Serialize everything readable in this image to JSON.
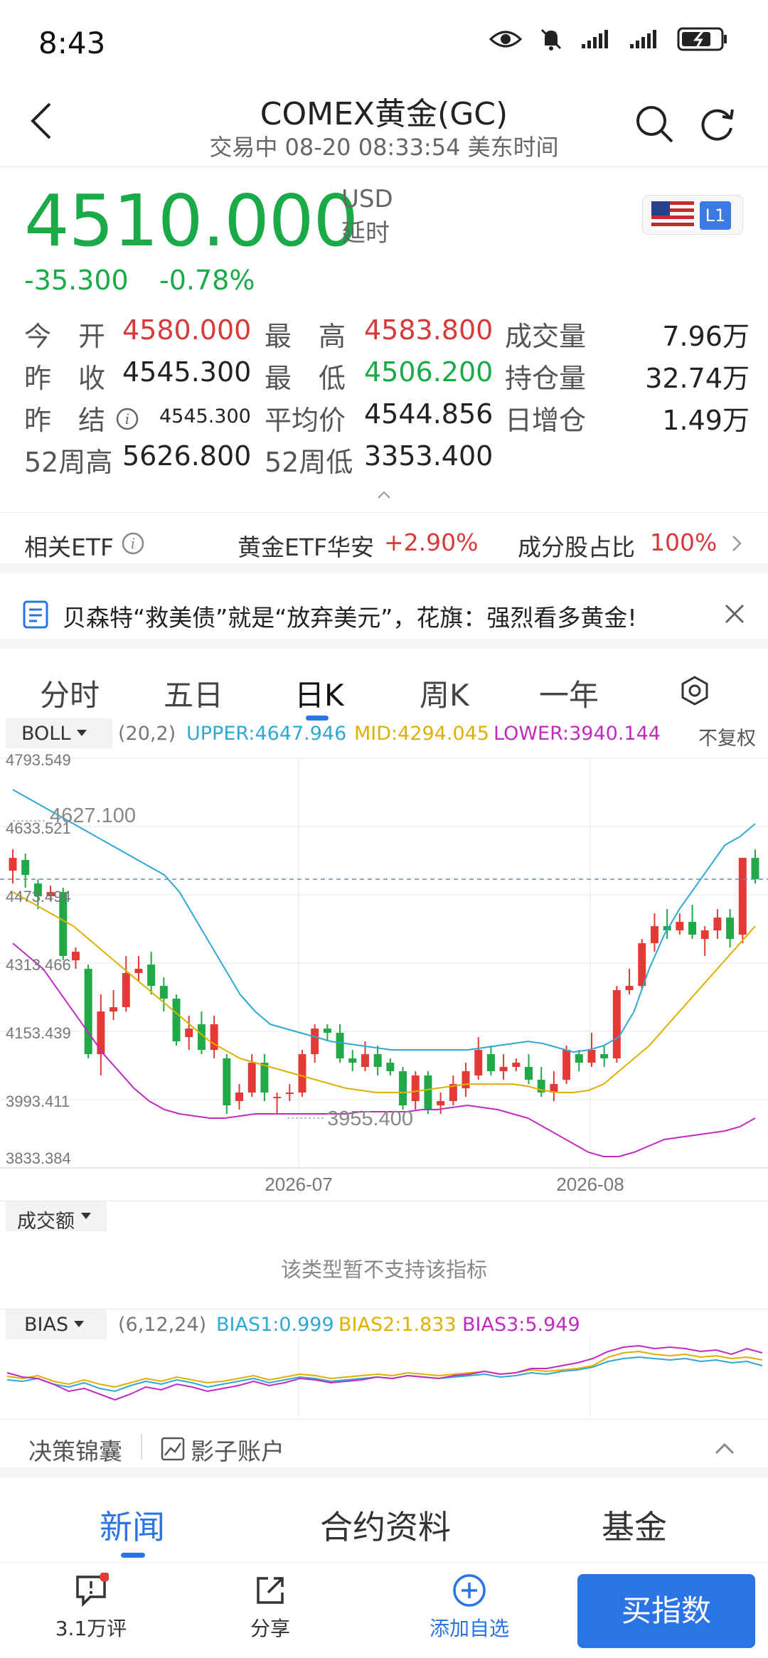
{
  "status_bar": {
    "time": "8:43"
  },
  "header": {
    "title": "COMEX黄金(GC)",
    "subtitle": "交易中 08-20 08:33:54 美东时间"
  },
  "quote": {
    "price": "4510.000",
    "currency": "USD",
    "delay": "延时",
    "change": "-35.300",
    "change_pct": "-0.78%",
    "level_badge": "L1"
  },
  "stats": [
    {
      "l1": "今　开",
      "v1": "4580.000",
      "c1": "red",
      "l2": "最　高",
      "v2": "4583.800",
      "c2": "red",
      "l3": "成交量",
      "v3": "7.96万"
    },
    {
      "l1": "昨　收",
      "v1": "4545.300",
      "c1": "",
      "l2": "最　低",
      "v2": "4506.200",
      "c2": "green",
      "l3": "持仓量",
      "v3": "32.74万"
    },
    {
      "l1": "昨　结",
      "v1": "4545.300",
      "c1": "",
      "l2": "平均价",
      "v2": "4544.856",
      "c2": "",
      "l3": "日增仓",
      "v3": "1.49万"
    },
    {
      "l1": "52周高",
      "v1": "5626.800",
      "c1": "",
      "l2": "52周低",
      "v2": "3353.400",
      "c2": "",
      "l3": "",
      "v3": ""
    }
  ],
  "etf": {
    "label": "相关ETF",
    "name": "黄金ETF华安",
    "change": "+2.90%",
    "ratio_label": "成分股占比",
    "ratio": "100%"
  },
  "news_banner": {
    "text": "贝森特“救美债”就是“放弃美元”，花旗：强烈看多黄金!"
  },
  "chart_tabs": [
    "分时",
    "五日",
    "日K",
    "周K",
    "一年"
  ],
  "active_tab": 2,
  "boll": {
    "name": "BOLL",
    "params": "(20,2)",
    "upper": "UPPER:4647.946",
    "mid": "MID:4294.045",
    "lower": "LOWER:3940.144",
    "adjust": "不复权",
    "colors": {
      "upper": "#2fa8d6",
      "mid": "#e0b000",
      "lower": "#c02bc0"
    }
  },
  "chart_data": {
    "type": "candlestick",
    "y_ticks": [
      "4793.549",
      "4633.521",
      "4473.494",
      "4313.466",
      "4153.439",
      "3993.411",
      "3833.384"
    ],
    "ylim": [
      3833.384,
      4793.549
    ],
    "x_ticks": [
      "2026-07",
      "2026-08"
    ],
    "annotations": {
      "high": "4627.100",
      "low": "3955.400"
    },
    "reference_price": 4510.0,
    "candles": [
      {
        "o": 4530,
        "c": 4560,
        "h": 4580,
        "l": 4500
      },
      {
        "o": 4555,
        "c": 4520,
        "h": 4570,
        "l": 4490
      },
      {
        "o": 4500,
        "c": 4470,
        "h": 4510,
        "l": 4440
      },
      {
        "o": 4470,
        "c": 4480,
        "h": 4495,
        "l": 4460
      },
      {
        "o": 4480,
        "c": 4330,
        "h": 4490,
        "l": 4320
      },
      {
        "o": 4320,
        "c": 4340,
        "h": 4350,
        "l": 4300
      },
      {
        "o": 4300,
        "c": 4100,
        "h": 4310,
        "l": 4090
      },
      {
        "o": 4100,
        "c": 4200,
        "h": 4240,
        "l": 4050
      },
      {
        "o": 4200,
        "c": 4210,
        "h": 4250,
        "l": 4180
      },
      {
        "o": 4210,
        "c": 4290,
        "h": 4330,
        "l": 4200
      },
      {
        "o": 4290,
        "c": 4300,
        "h": 4330,
        "l": 4270
      },
      {
        "o": 4310,
        "c": 4260,
        "h": 4340,
        "l": 4240
      },
      {
        "o": 4260,
        "c": 4230,
        "h": 4280,
        "l": 4200
      },
      {
        "o": 4230,
        "c": 4130,
        "h": 4240,
        "l": 4120
      },
      {
        "o": 4140,
        "c": 4160,
        "h": 4190,
        "l": 4110
      },
      {
        "o": 4170,
        "c": 4110,
        "h": 4200,
        "l": 4100
      },
      {
        "o": 4110,
        "c": 4170,
        "h": 4190,
        "l": 4090
      },
      {
        "o": 4090,
        "c": 3980,
        "h": 4100,
        "l": 3960
      },
      {
        "o": 3990,
        "c": 4010,
        "h": 4030,
        "l": 3970
      },
      {
        "o": 4010,
        "c": 4080,
        "h": 4100,
        "l": 4000
      },
      {
        "o": 4080,
        "c": 4010,
        "h": 4100,
        "l": 3990
      },
      {
        "o": 4000,
        "c": 4000,
        "h": 4010,
        "l": 3960
      },
      {
        "o": 4010,
        "c": 4010,
        "h": 4030,
        "l": 3990
      },
      {
        "o": 4010,
        "c": 4100,
        "h": 4110,
        "l": 4000
      },
      {
        "o": 4100,
        "c": 4160,
        "h": 4170,
        "l": 4080
      },
      {
        "o": 4160,
        "c": 4150,
        "h": 4170,
        "l": 4130
      },
      {
        "o": 4150,
        "c": 4090,
        "h": 4170,
        "l": 4080
      },
      {
        "o": 4090,
        "c": 4080,
        "h": 4110,
        "l": 4060
      },
      {
        "o": 4070,
        "c": 4100,
        "h": 4130,
        "l": 4060
      },
      {
        "o": 4100,
        "c": 4070,
        "h": 4120,
        "l": 4050
      },
      {
        "o": 4080,
        "c": 4060,
        "h": 4090,
        "l": 4050
      },
      {
        "o": 4060,
        "c": 3980,
        "h": 4070,
        "l": 3970
      },
      {
        "o": 3990,
        "c": 4050,
        "h": 4060,
        "l": 3970
      },
      {
        "o": 4050,
        "c": 3970,
        "h": 4060,
        "l": 3960
      },
      {
        "o": 3980,
        "c": 3990,
        "h": 4010,
        "l": 3960
      },
      {
        "o": 3990,
        "c": 4030,
        "h": 4050,
        "l": 3980
      },
      {
        "o": 4020,
        "c": 4060,
        "h": 4080,
        "l": 4000
      },
      {
        "o": 4050,
        "c": 4110,
        "h": 4140,
        "l": 4040
      },
      {
        "o": 4100,
        "c": 4060,
        "h": 4120,
        "l": 4050
      },
      {
        "o": 4060,
        "c": 4070,
        "h": 4100,
        "l": 4040
      },
      {
        "o": 4070,
        "c": 4080,
        "h": 4090,
        "l": 4060
      },
      {
        "o": 4070,
        "c": 4040,
        "h": 4100,
        "l": 4030
      },
      {
        "o": 4040,
        "c": 4010,
        "h": 4070,
        "l": 4000
      },
      {
        "o": 4010,
        "c": 4030,
        "h": 4060,
        "l": 3990
      },
      {
        "o": 4040,
        "c": 4110,
        "h": 4120,
        "l": 4030
      },
      {
        "o": 4100,
        "c": 4080,
        "h": 4110,
        "l": 4060
      },
      {
        "o": 4080,
        "c": 4110,
        "h": 4150,
        "l": 4070
      },
      {
        "o": 4100,
        "c": 4090,
        "h": 4120,
        "l": 4070
      },
      {
        "o": 4090,
        "c": 4250,
        "h": 4260,
        "l": 4080
      },
      {
        "o": 4250,
        "c": 4260,
        "h": 4300,
        "l": 4240
      },
      {
        "o": 4260,
        "c": 4360,
        "h": 4370,
        "l": 4250
      },
      {
        "o": 4360,
        "c": 4400,
        "h": 4430,
        "l": 4340
      },
      {
        "o": 4400,
        "c": 4390,
        "h": 4440,
        "l": 4370
      },
      {
        "o": 4390,
        "c": 4410,
        "h": 4430,
        "l": 4380
      },
      {
        "o": 4410,
        "c": 4380,
        "h": 4450,
        "l": 4370
      },
      {
        "o": 4370,
        "c": 4390,
        "h": 4400,
        "l": 4330
      },
      {
        "o": 4390,
        "c": 4420,
        "h": 4440,
        "l": 4370
      },
      {
        "o": 4420,
        "c": 4370,
        "h": 4440,
        "l": 4350
      },
      {
        "o": 4380,
        "c": 4560,
        "h": 4560,
        "l": 4360
      },
      {
        "o": 4560,
        "c": 4510,
        "h": 4580,
        "l": 4500
      }
    ],
    "upper": [
      4720,
      4700,
      4680,
      4660,
      4640,
      4620,
      4600,
      4580,
      4560,
      4540,
      4520,
      4480,
      4420,
      4360,
      4300,
      4240,
      4200,
      4170,
      4160,
      4150,
      4140,
      4130,
      4125,
      4120,
      4115,
      4110,
      4110,
      4110,
      4110,
      4110,
      4110,
      4115,
      4120,
      4125,
      4130,
      4125,
      4115,
      4105,
      4110,
      4120,
      4140,
      4200,
      4300,
      4380,
      4440,
      4490,
      4540,
      4590,
      4610,
      4640
    ],
    "mid": [
      4480,
      4460,
      4440,
      4420,
      4400,
      4370,
      4340,
      4310,
      4280,
      4250,
      4220,
      4190,
      4160,
      4130,
      4110,
      4090,
      4080,
      4070,
      4060,
      4050,
      4040,
      4030,
      4020,
      4015,
      4010,
      4010,
      4010,
      4015,
      4020,
      4025,
      4030,
      4030,
      4030,
      4030,
      4025,
      4015,
      4010,
      4010,
      4015,
      4030,
      4060,
      4090,
      4120,
      4160,
      4200,
      4240,
      4280,
      4320,
      4360,
      4400
    ],
    "lower": [
      4360,
      4330,
      4300,
      4250,
      4200,
      4150,
      4100,
      4060,
      4020,
      3990,
      3970,
      3960,
      3955,
      3950,
      3950,
      3955,
      3960,
      3960,
      3960,
      3960,
      3960,
      3960,
      3960,
      3965,
      3965,
      3965,
      3965,
      3970,
      3970,
      3975,
      3980,
      3975,
      3970,
      3960,
      3950,
      3930,
      3910,
      3890,
      3870,
      3860,
      3860,
      3870,
      3885,
      3900,
      3905,
      3910,
      3915,
      3920,
      3930,
      3950
    ]
  },
  "volume": {
    "name": "成交额",
    "notice": "该类型暂不支持该指标"
  },
  "bias": {
    "name": "BIAS",
    "params": "(6,12,24)",
    "b1": "BIAS1:0.999",
    "b2": "BIAS2:1.833",
    "b3": "BIAS3:5.949",
    "colors": {
      "b1": "#2fa8d6",
      "b2": "#e0b000",
      "b3": "#c02bc0"
    }
  },
  "decision": {
    "left": "决策锦囊",
    "right": "影子账户"
  },
  "bottom_tabs": [
    "新闻",
    "合约资料",
    "基金"
  ],
  "tabbar": {
    "comments": "3.1万评",
    "share": "分享",
    "watch": "添加自选",
    "buy": "买指数"
  }
}
